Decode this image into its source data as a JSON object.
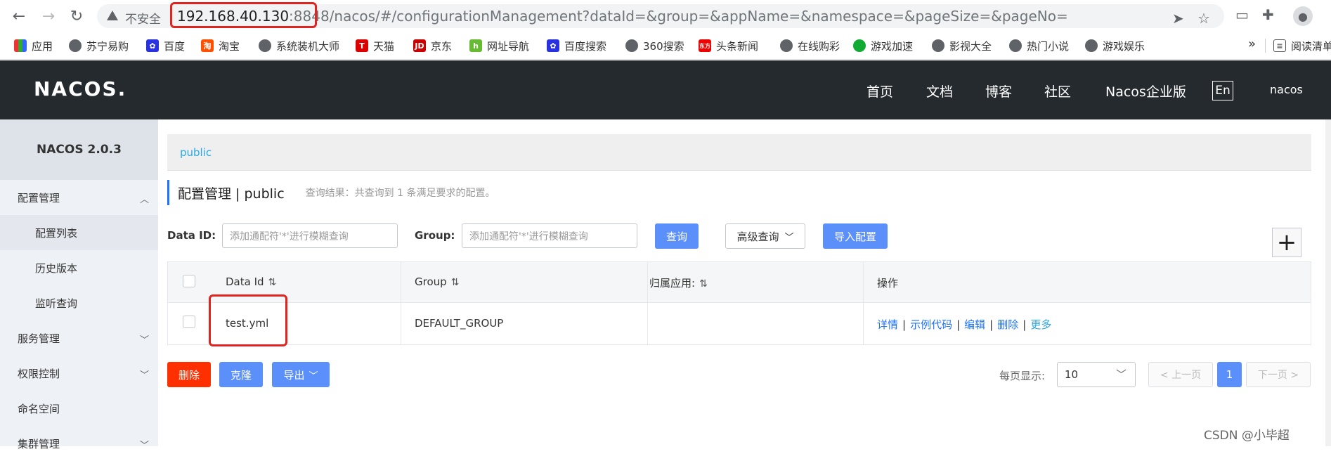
{
  "browser": {
    "insecure_label": "不安全",
    "url_host": "192.168.40.130",
    "url_port": ":8848",
    "url_path": "/nacos/#/configurationManagement?dataId=&group=&appName=&namespace=&pageSize=&pageNo="
  },
  "bookmarks": [
    {
      "label": "应用",
      "icon": "apps-grid-icon"
    },
    {
      "label": "苏宁易购",
      "icon": "globe-icon"
    },
    {
      "label": "百度",
      "icon": "baidu-icon"
    },
    {
      "label": "淘宝",
      "icon": "taobao-icon"
    },
    {
      "label": "系统装机大师",
      "icon": "globe-icon"
    },
    {
      "label": "天猫",
      "icon": "tmall-icon"
    },
    {
      "label": "京东",
      "icon": "jd-icon"
    },
    {
      "label": "网址导航",
      "icon": "hao-icon"
    },
    {
      "label": "百度搜索",
      "icon": "baidu-icon"
    },
    {
      "label": "360搜索",
      "icon": "globe-icon"
    },
    {
      "label": "头条新闻",
      "icon": "toutiao-icon"
    },
    {
      "label": "在线购彩",
      "icon": "globe-icon"
    },
    {
      "label": "游戏加速",
      "icon": "game-icon"
    },
    {
      "label": "影视大全",
      "icon": "globe-icon"
    },
    {
      "label": "热门小说",
      "icon": "globe-icon"
    },
    {
      "label": "游戏娱乐",
      "icon": "globe-icon"
    },
    {
      "label": "阅读清单",
      "icon": "reading-list-icon"
    }
  ],
  "bookmarks_more": "»",
  "header": {
    "logo": "NACOS.",
    "nav": [
      "首页",
      "文档",
      "博客",
      "社区",
      "Nacos企业版"
    ],
    "lang": "En",
    "user": "nacos"
  },
  "sidebar": {
    "title": "NACOS 2.0.3",
    "items": [
      {
        "label": "配置管理"
      },
      {
        "label": "配置列表"
      },
      {
        "label": "历史版本"
      },
      {
        "label": "监听查询"
      },
      {
        "label": "服务管理"
      },
      {
        "label": "权限控制"
      },
      {
        "label": "命名空间"
      },
      {
        "label": "集群管理"
      }
    ]
  },
  "namespace": {
    "current": "public"
  },
  "page": {
    "title": "配置管理 | public",
    "result": "查询结果：共查询到 1 条满足要求的配置。"
  },
  "filters": {
    "dataid_label": "Data ID:",
    "dataid_placeholder": "添加通配符'*'进行模糊查询",
    "group_label": "Group:",
    "group_placeholder": "添加通配符'*'进行模糊查询",
    "query_btn": "查询",
    "advanced_btn": "高级查询",
    "import_btn": "导入配置"
  },
  "table": {
    "headers": [
      "Data Id",
      "Group",
      "归属应用:",
      "操作"
    ],
    "rows": [
      {
        "data_id": "test.yml",
        "group": "DEFAULT_GROUP",
        "app": "",
        "ops": [
          "详情",
          "示例代码",
          "编辑",
          "删除",
          "更多"
        ]
      }
    ]
  },
  "actions": {
    "delete_btn": "删除",
    "clone_btn": "克隆",
    "export_btn": "导出"
  },
  "pager": {
    "label": "每页显示:",
    "page_size": "10",
    "prev": "< 上一页",
    "current": "1",
    "next": "下一页 >"
  },
  "watermark": "CSDN @小毕超",
  "colors": {
    "primary": "#5b8ff9",
    "danger": "#ff3000",
    "header_bg": "#252a2f",
    "highlight_box": "#e0241f"
  }
}
